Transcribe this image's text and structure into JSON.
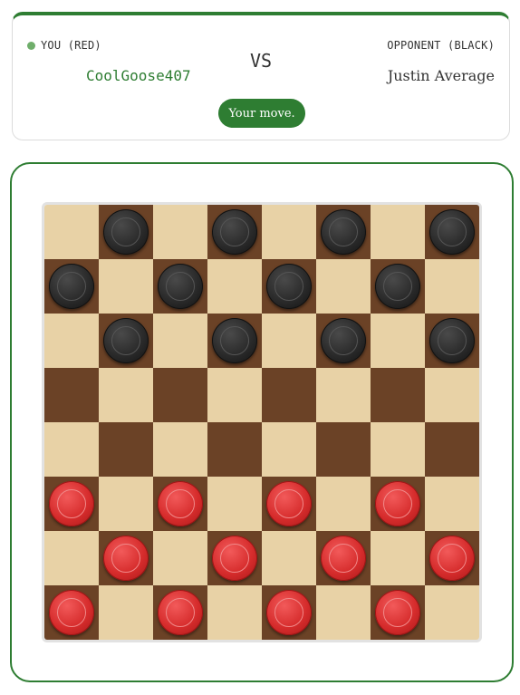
{
  "players": {
    "you": {
      "label": "YOU (RED)",
      "name": "CoolGoose407",
      "active": true
    },
    "opponent": {
      "label": "OPPONENT (BLACK)",
      "name": "Justin Average"
    },
    "vs_text": "VS"
  },
  "status": {
    "text": "Your move."
  },
  "colors": {
    "accent": "#2e7d32",
    "light_square": "#e8d2a6",
    "dark_square": "#6b4226",
    "red_piece": "#d62c2c",
    "black_piece": "#2a2a2a"
  },
  "board": {
    "size": 8,
    "rows": [
      ".b.b.b.b",
      "b.b.b.b.",
      ".b.b.b.b",
      "........",
      "........",
      "r.r.r.r.",
      ".r.r.r.r",
      "r.r.r.r."
    ]
  }
}
